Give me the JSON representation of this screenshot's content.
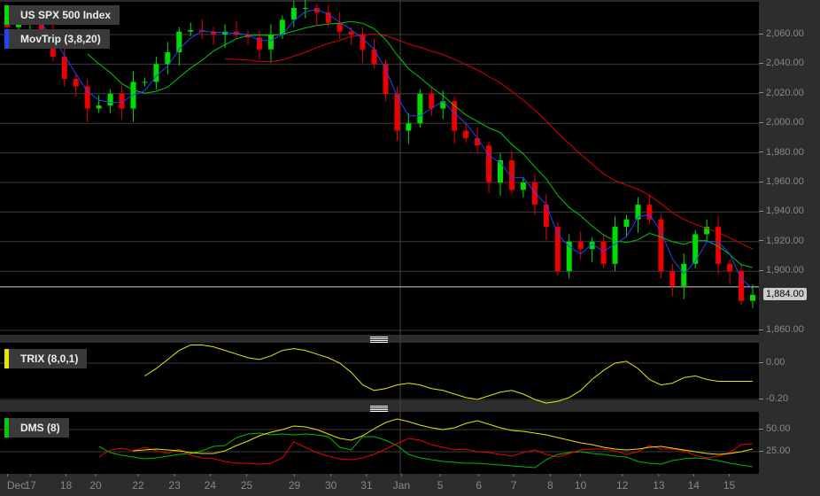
{
  "main": {
    "title": "US SPX 500 Index",
    "indicator": "MovTrip (3,8,20)",
    "current_price": "1,884.00",
    "current_value": 1884,
    "y_labels": [
      {
        "v": 2060,
        "t": "2,060.00"
      },
      {
        "v": 2040,
        "t": "2,040.00"
      },
      {
        "v": 2020,
        "t": "2,020.00"
      },
      {
        "v": 2000,
        "t": "2,000.00"
      },
      {
        "v": 1980,
        "t": "1,980.00"
      },
      {
        "v": 1960,
        "t": "1,960.00"
      },
      {
        "v": 1940,
        "t": "1,940.00"
      },
      {
        "v": 1920,
        "t": "1,920.00"
      },
      {
        "v": 1900,
        "t": "1,900.00"
      },
      {
        "v": 1860,
        "t": "1,860.00"
      }
    ],
    "closes": [
      2065,
      2068,
      2070,
      2062,
      2045,
      2030,
      2025,
      2010,
      2012,
      2020,
      2010,
      2028,
      2028,
      2040,
      2048,
      2062,
      2063,
      2062,
      2060,
      2062,
      2060,
      2058,
      2050,
      2060,
      2070,
      2078,
      2078,
      2075,
      2068,
      2062,
      2060,
      2050,
      2040,
      2020,
      1995,
      2000,
      2020,
      2010,
      2015,
      1995,
      1990,
      1985,
      1960,
      1975,
      1955,
      1960,
      1945,
      1930,
      1900,
      1920,
      1915,
      1920,
      1905,
      1930,
      1935,
      1945,
      1935,
      1900,
      1890,
      1905,
      1925,
      1930,
      1905,
      1900,
      1880,
      1884
    ],
    "colors": {
      "up": "#00dd00",
      "down": "#ee0000",
      "ma3": "#2244ff",
      "ma8": "#00cc00",
      "ma20": "#dd0000"
    }
  },
  "trix": {
    "title": "TRIX (8,0,1)",
    "y_labels": [
      {
        "v": 0,
        "t": "0.00"
      },
      {
        "v": -0.2,
        "t": "-0.20"
      }
    ],
    "values": [
      null,
      null,
      null,
      null,
      null,
      null,
      null,
      null,
      null,
      null,
      null,
      null,
      -0.07,
      -0.03,
      0.02,
      0.07,
      0.1,
      0.1,
      0.09,
      0.07,
      0.05,
      0.03,
      0.02,
      0.04,
      0.07,
      0.08,
      0.07,
      0.05,
      0.03,
      0.0,
      -0.05,
      -0.12,
      -0.15,
      -0.14,
      -0.12,
      -0.11,
      -0.12,
      -0.14,
      -0.15,
      -0.17,
      -0.19,
      -0.2,
      -0.18,
      -0.16,
      -0.15,
      -0.17,
      -0.2,
      -0.22,
      -0.21,
      -0.19,
      -0.15,
      -0.09,
      -0.04,
      0.0,
      0.01,
      -0.03,
      -0.09,
      -0.12,
      -0.11,
      -0.08,
      -0.07,
      -0.09,
      -0.1,
      -0.1,
      -0.1,
      -0.1
    ],
    "color": "#e6e600"
  },
  "dms": {
    "title": "DMS (8)",
    "y_labels": [
      {
        "v": 50,
        "t": "50.00"
      },
      {
        "v": 25,
        "t": "25.00"
      }
    ],
    "series": [
      {
        "name": "DI+",
        "color": "#00bb00",
        "values": [
          null,
          null,
          null,
          null,
          null,
          null,
          null,
          null,
          31,
          24,
          21,
          19,
          17,
          18,
          20,
          22,
          23,
          26,
          31,
          32,
          41,
          45,
          46,
          44,
          45,
          44,
          45,
          44,
          42,
          30,
          27,
          42,
          42,
          38,
          32,
          22,
          18,
          16,
          14,
          13,
          12,
          12,
          11,
          10,
          9,
          8,
          7,
          16,
          22,
          24,
          25,
          23,
          22,
          20,
          19,
          14,
          12,
          11,
          15,
          17,
          18,
          17,
          15,
          12,
          10,
          8
        ]
      },
      {
        "name": "DI-",
        "color": "#ee0000",
        "values": [
          null,
          null,
          null,
          null,
          null,
          null,
          null,
          null,
          19,
          27,
          29,
          26,
          30,
          26,
          23,
          28,
          21,
          18,
          17,
          14,
          12,
          12,
          11,
          12,
          18,
          36,
          30,
          24,
          20,
          17,
          16,
          18,
          22,
          28,
          34,
          40,
          38,
          33,
          30,
          27,
          28,
          25,
          24,
          22,
          20,
          24,
          27,
          22,
          19,
          23,
          27,
          28,
          28,
          26,
          22,
          25,
          32,
          28,
          28,
          26,
          21,
          18,
          20,
          24,
          33,
          34
        ]
      },
      {
        "name": "ADX",
        "color": "#e6e600",
        "values": [
          null,
          null,
          null,
          null,
          null,
          null,
          null,
          null,
          null,
          null,
          null,
          26,
          27,
          28,
          27,
          26,
          24,
          23,
          23,
          26,
          32,
          37,
          43,
          47,
          50,
          54,
          53,
          50,
          45,
          40,
          38,
          43,
          51,
          58,
          62,
          59,
          55,
          52,
          50,
          52,
          57,
          60,
          56,
          52,
          49,
          48,
          46,
          44,
          41,
          38,
          35,
          33,
          30,
          28,
          27,
          28,
          30,
          31,
          29,
          27,
          25,
          23,
          22,
          23,
          25,
          28
        ]
      }
    ]
  },
  "x_axis": [
    {
      "t": "Dec",
      "x": 0.01
    },
    {
      "t": "17",
      "x": 0.04
    },
    {
      "t": "18",
      "x": 0.087
    },
    {
      "t": "20",
      "x": 0.126
    },
    {
      "t": "22",
      "x": 0.182
    },
    {
      "t": "23",
      "x": 0.23
    },
    {
      "t": "24",
      "x": 0.277
    },
    {
      "t": "25",
      "x": 0.325
    },
    {
      "t": "29",
      "x": 0.388
    },
    {
      "t": "30",
      "x": 0.436
    },
    {
      "t": "31",
      "x": 0.483
    },
    {
      "t": "Jan",
      "x": 0.529
    },
    {
      "t": "5",
      "x": 0.58
    },
    {
      "t": "6",
      "x": 0.631
    },
    {
      "t": "7",
      "x": 0.677
    },
    {
      "t": "8",
      "x": 0.725
    },
    {
      "t": "10",
      "x": 0.765
    },
    {
      "t": "12",
      "x": 0.82
    },
    {
      "t": "13",
      "x": 0.868
    },
    {
      "t": "14",
      "x": 0.914
    },
    {
      "t": "15",
      "x": 0.961
    }
  ]
}
